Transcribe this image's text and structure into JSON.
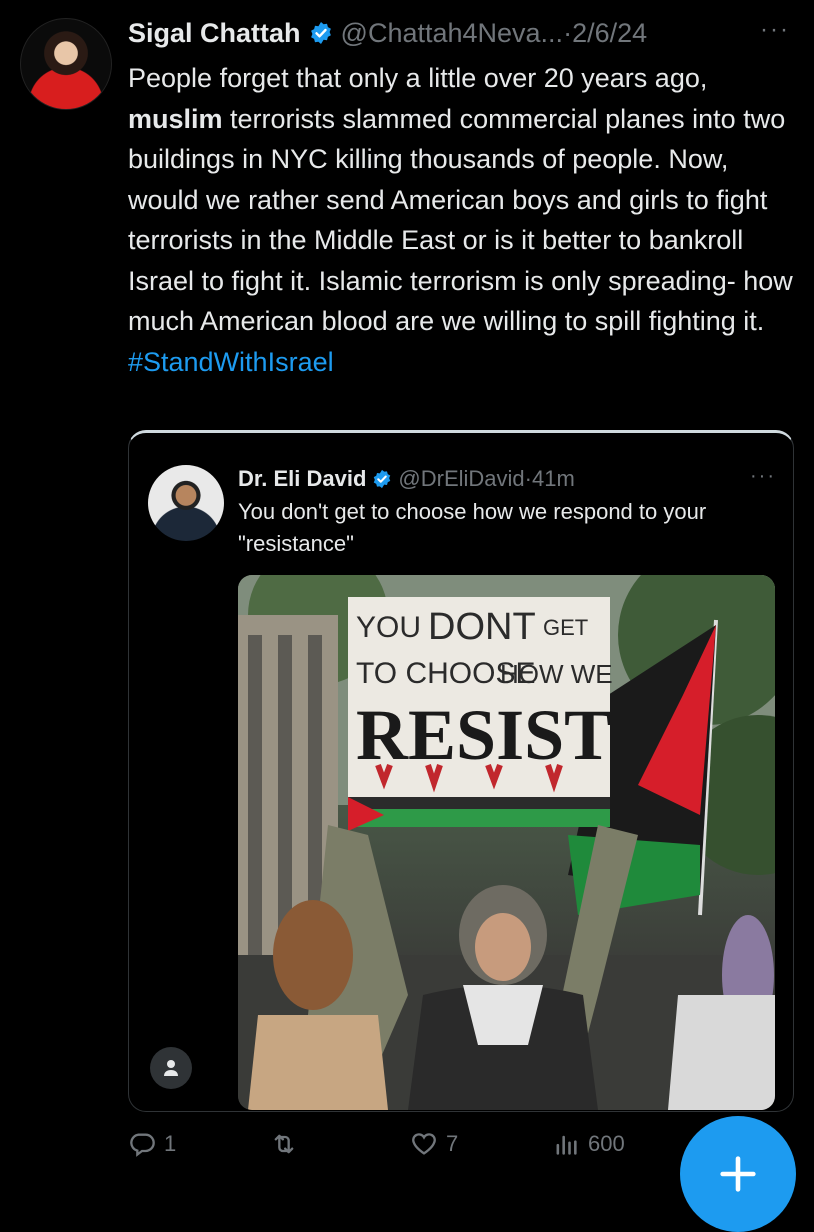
{
  "tweet": {
    "author_name": "Sigal Chattah",
    "handle": "@Chattah4Neva...",
    "separator": "·",
    "date": "2/6/24",
    "more": "···",
    "text_pre": "People forget that only a little over 20 years ago, ",
    "text_bold": "muslim",
    "text_post": " terrorists slammed commercial planes into two buildings in NYC killing thousands of people. Now, would we rather send American boys and girls to fight terrorists in the Middle East or is it better to bankroll Israel to fight it. Islamic terrorism is only spreading- how much American blood are we willing to spill fighting it.",
    "hashtag": "#StandWithIsrael"
  },
  "quote": {
    "author_name": "Dr. Eli David",
    "handle": "@DrEliDavid",
    "separator": "·",
    "time": "41m",
    "more": "···",
    "text": "You don't get to choose how we respond to your \"resistance\"",
    "sign_line1a": "YOU",
    "sign_line1b": "DONT",
    "sign_line1c": "GET",
    "sign_line2a": "TO CHOOSE",
    "sign_line2b": "HOW WE",
    "sign_line3": "RESIST"
  },
  "actions": {
    "reply_count": "1",
    "retweet_count": "",
    "like_count": "7",
    "views_count": "600"
  },
  "icons": {
    "reply": "reply-icon",
    "retweet": "retweet-icon",
    "like": "heart-icon",
    "views": "views-icon",
    "bookmark": "bookmark-icon",
    "share": "share-icon",
    "compose": "compose-plus-icon",
    "verified": "verified-badge-icon",
    "person": "person-icon"
  },
  "colors": {
    "background": "#000000",
    "text": "#e7e9ea",
    "muted": "#71767b",
    "accent": "#1d9bf0"
  }
}
